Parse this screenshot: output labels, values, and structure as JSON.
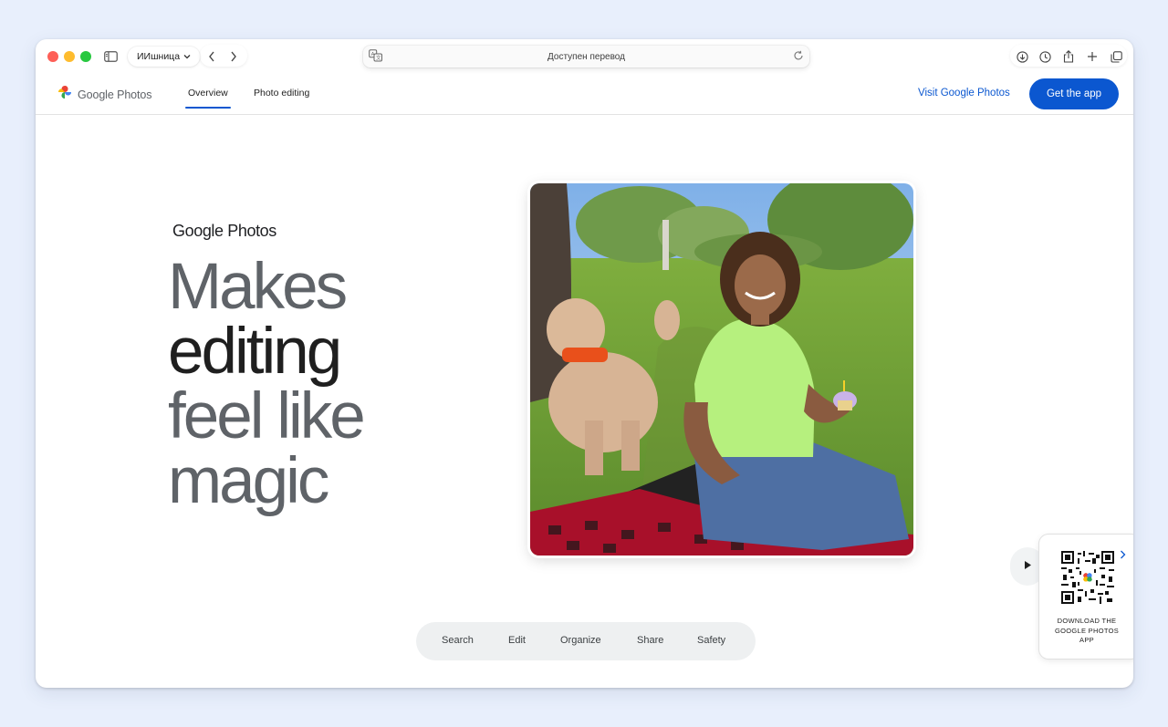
{
  "browser": {
    "profile_label": "ИИшница",
    "address_text": "Доступен перевод"
  },
  "site": {
    "logo_text": "Google Photos",
    "nav_tabs": [
      {
        "label": "Overview",
        "active": true
      },
      {
        "label": "Photo editing",
        "active": false
      }
    ],
    "visit_link": "Visit Google Photos",
    "get_app_label": "Get the app",
    "accent_color": "#0b57d0"
  },
  "hero": {
    "brand": "Google Photos",
    "title_lines": [
      "Makes",
      "editing",
      "feel like",
      "magic"
    ],
    "photo_alt": "Woman smiling with a poodle on a picnic blanket in a park, holding a cupcake"
  },
  "qr_card": {
    "text_line1": "DOWNLOAD THE",
    "text_line2": "GOOGLE PHOTOS",
    "text_line3": "APP"
  },
  "features": [
    "Search",
    "Edit",
    "Organize",
    "Share",
    "Safety"
  ],
  "icons": {
    "sidebar": "sidebar-icon",
    "back": "chevron-left-icon",
    "forward": "chevron-right-icon",
    "translate": "translate-icon",
    "reload": "reload-icon",
    "download": "download-icon",
    "history": "clock-icon",
    "share": "share-icon",
    "new_tab": "plus-icon",
    "tabs": "tabs-icon",
    "play": "play-icon"
  }
}
